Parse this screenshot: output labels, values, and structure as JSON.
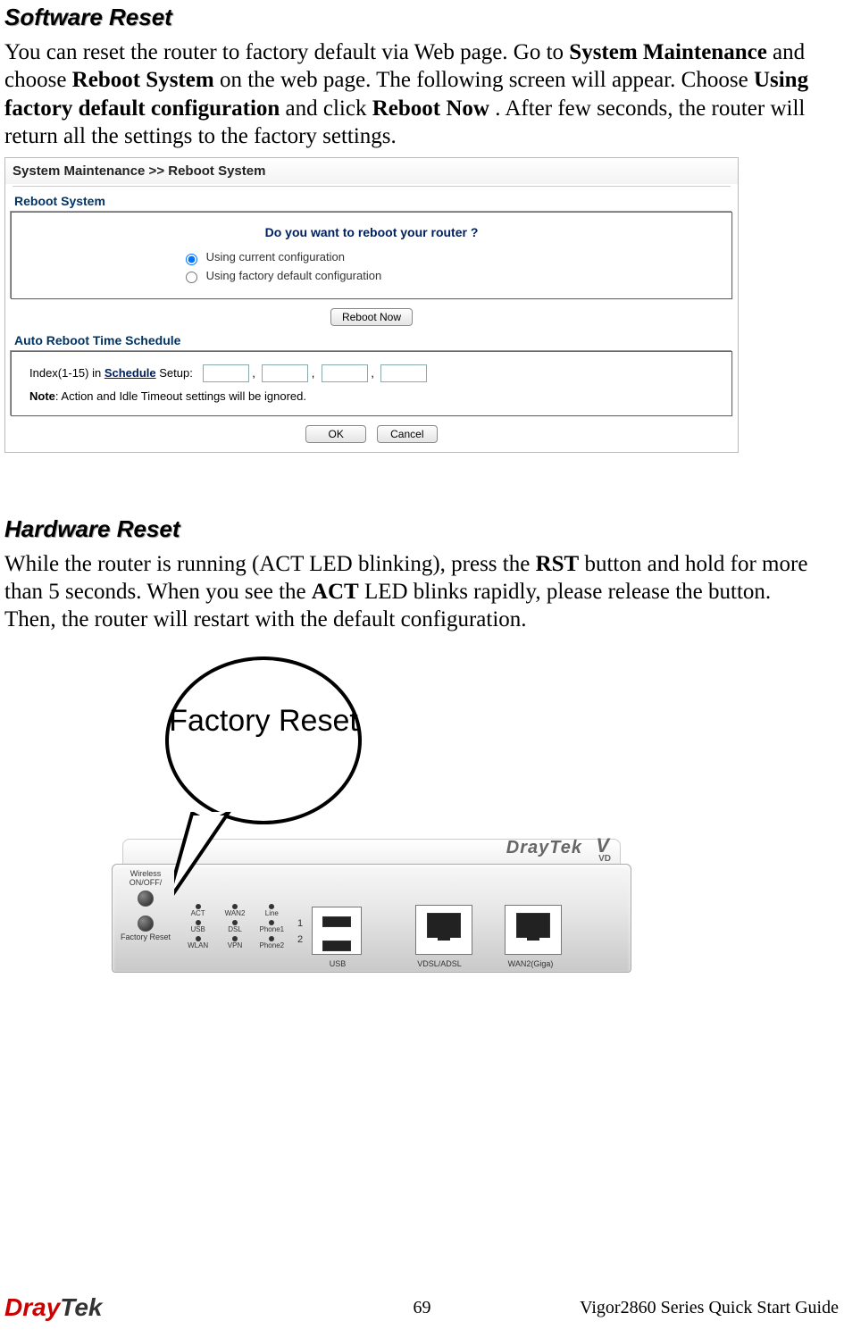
{
  "section1": {
    "heading": "Software Reset",
    "para_parts": {
      "t1": "You can reset the router to factory default via Web page. Go to ",
      "b1": "System Maintenance",
      "t2": " and choose ",
      "b2": "Reboot System",
      "t3": " on the web page. The following screen will appear. Choose ",
      "b3": "Using factory default configuration",
      "t4": " and click ",
      "b4": "Reboot Now",
      "t5": ". After few seconds, the router will return all the settings to the factory settings."
    }
  },
  "router_ui": {
    "breadcrumb": "System Maintenance >> Reboot System",
    "sub_reboot": "Reboot System",
    "question": "Do you want to reboot your router ?",
    "radio1": "Using current configuration",
    "radio2": "Using factory default configuration",
    "option_selected": "current",
    "btn_reboot": "Reboot Now",
    "sub_sched": "Auto Reboot Time Schedule",
    "sched_prefix": "Index(1-15) in ",
    "sched_link": "Schedule",
    "sched_suffix": " Setup:",
    "sched_slots": [
      "",
      "",
      "",
      ""
    ],
    "note_label": "Note",
    "note_text": ": Action and Idle Timeout settings will be ignored.",
    "btn_ok": "OK",
    "btn_cancel": "Cancel"
  },
  "section2": {
    "heading": "Hardware Reset",
    "para_parts": {
      "t1": "While the router is running (ACT LED blinking), press the ",
      "b1": "RST",
      "t2": " button and hold for more than 5 seconds. When you see the ",
      "b2": "ACT",
      "t3": " LED blinks rapidly, please release the button. Then, the router will restart with the default configuration."
    }
  },
  "illustration": {
    "bubble_text": "Factory Reset",
    "side_btn1": "Wireless ON/OFF/",
    "side_btn2": "Factory Reset",
    "leds_row1": [
      "ACT",
      "WAN2",
      "Line"
    ],
    "leds_row2": [
      "USB",
      "DSL",
      "Phone1"
    ],
    "leds_row3": [
      "WLAN",
      "VPN",
      "Phone2"
    ],
    "port_num1": "1",
    "port_num2": "2",
    "port_usb": "USB",
    "port_vdsl": "VDSL/ADSL",
    "port_wan2": "WAN2(Giga)",
    "brand": "DrayTek",
    "brand_v": "V",
    "brand_vd": "VD"
  },
  "footer": {
    "logo_left": "Dray",
    "logo_right": "Tek",
    "page_number": "69",
    "doc_title": "Vigor2860 Series Quick Start Guide"
  }
}
